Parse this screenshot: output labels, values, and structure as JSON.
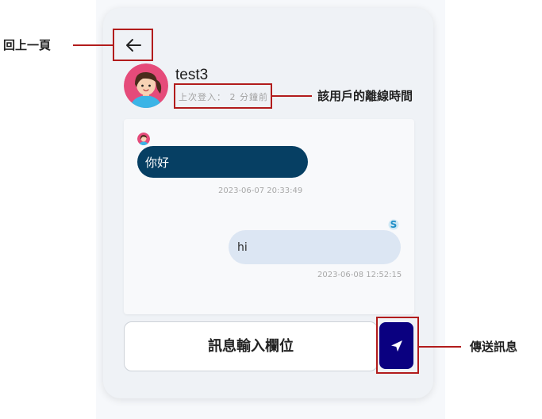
{
  "chat": {
    "username": "test3",
    "last_login": "上次登入： 2 分鐘前",
    "messages": [
      {
        "sender": "other",
        "text": "你好",
        "time": "2023-06-07 20:33:49"
      },
      {
        "sender": "self",
        "text": "hi",
        "time": "2023-06-08 12:52:15"
      }
    ],
    "input_placeholder": "訊息輸入欄位",
    "self_badge": "S"
  },
  "annotations": {
    "back": "回上一頁",
    "offline_time": "該用戶的離線時間",
    "send": "傳送訊息"
  },
  "icons": {
    "back": "arrow-left-icon",
    "send": "paper-plane-icon",
    "avatar": "girl-avatar-icon"
  },
  "colors": {
    "incoming_bubble": "#063f63",
    "outgoing_bubble": "#dce6f3",
    "send_button": "#0a0080",
    "highlight": "#b21c1c"
  }
}
